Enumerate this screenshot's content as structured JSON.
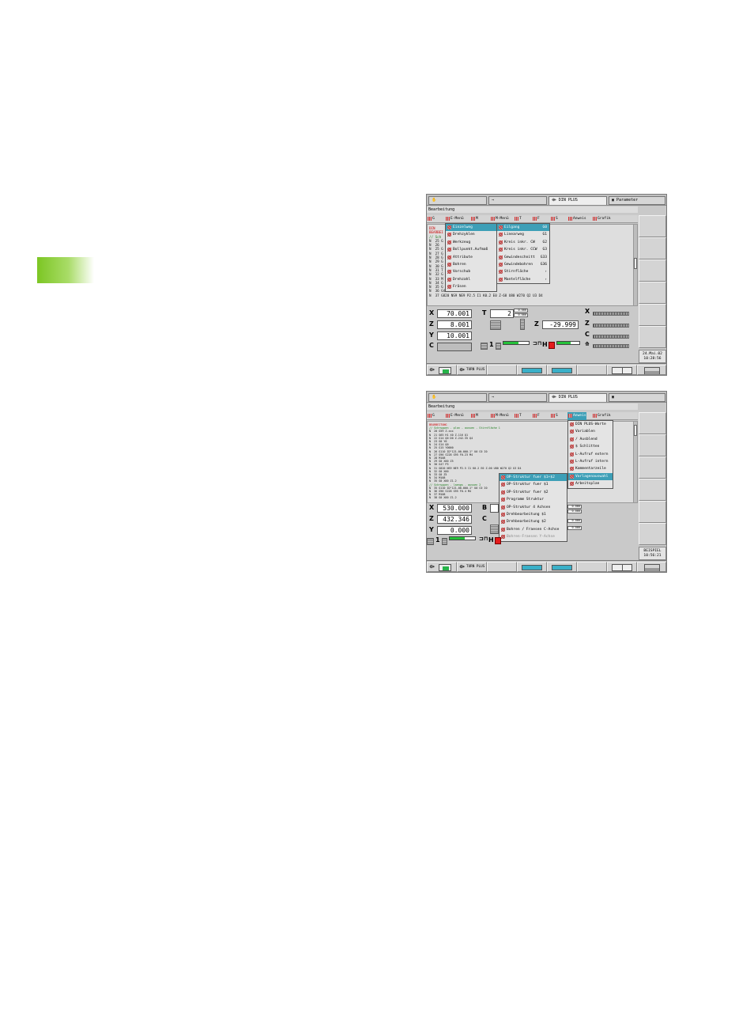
{
  "screens": [
    {
      "tabs": [
        "✋",
        "⇒",
        "DIN PLUS",
        "Parameter"
      ],
      "status": "Bearbeitung",
      "menubar": [
        "G",
        "E-Menü",
        "M",
        "M-Menü",
        "T",
        "F",
        "S",
        "Anweis",
        "Grafik"
      ],
      "program_lines": [
        {
          "t": "DIN",
          "c": "hd"
        },
        {
          "t": "BEARBEI",
          "c": "hd"
        },
        {
          "t": "// Sch",
          "c": "cm"
        },
        {
          "t": "N  25 G",
          "c": ""
        },
        {
          "t": "N  26 ",
          "c": ""
        },
        {
          "t": "N  25 G",
          "c": ""
        },
        {
          "t": "N  27 G",
          "c": ""
        },
        {
          "t": "N  28 G",
          "c": ""
        },
        {
          "t": "N  29 G",
          "c": ""
        },
        {
          "t": "N  30 G",
          "c": ""
        },
        {
          "t": "N  31 T",
          "c": ""
        },
        {
          "t": "N  32 G",
          "c": ""
        },
        {
          "t": "N  33 M",
          "c": ""
        },
        {
          "t": "N  34 G",
          "c": ""
        },
        {
          "t": "N  35 G",
          "c": ""
        },
        {
          "t": "N  36 G47 P3",
          "c": ""
        },
        {
          "t": "N  37 G820 NS9 NE9 P2.5 I1 K0.2 E0 Z-68 U80 W270 Q2 U3 D4",
          "c": ""
        }
      ],
      "submenu1": [
        "Einzelweg",
        "Drehzyklen",
        "Werkzeug",
        "Bollpunkt.Aufmaß",
        "Attribute",
        "Bohren",
        "Vorschub",
        "Drehzahl",
        "Fräsen"
      ],
      "submenu2": [
        {
          "label": "Eilgang",
          "code": "G0"
        },
        {
          "label": "Linearweg",
          "code": "G1"
        },
        {
          "label": "Kreis inkr. CW",
          "code": "G2"
        },
        {
          "label": "Kreis inkr. CCW",
          "code": "G3"
        },
        {
          "label": "Gewindeschnitt",
          "code": "G33"
        },
        {
          "label": "Gewindebohren",
          "code": "G36"
        },
        {
          "label": "Stirnfläche",
          "code": ""
        },
        {
          "label": "Mantelfläche",
          "code": ""
        }
      ],
      "axes": {
        "X": "70.001",
        "Z": "8.001",
        "Y": "10.001"
      },
      "tool": {
        "label": "T",
        "value": "2",
        "small": [
          "0.000",
          "0.000"
        ]
      },
      "z2": "-29.999",
      "h_label": "H",
      "counter": "1",
      "clock": [
        "24.Mai.02",
        "10:28:56"
      ],
      "bottom": [
        "TURN PLUS"
      ],
      "progress": {
        "fill": 0.6
      }
    },
    {
      "tabs": [
        "✋",
        "⇒",
        "DIN PLUS",
        ""
      ],
      "status": "Bearbeitung",
      "menubar": [
        "G",
        "E-Menü",
        "M",
        "M-Menü",
        "T",
        "F",
        "S",
        "Anweis",
        "Grafik"
      ],
      "program_lines": [
        {
          "t": "BEARBEITUNG",
          "c": "hd"
        },
        {
          "t": "// Schruppen - plan - aussen - Stirnfläche 1",
          "c": "cm"
        },
        {
          "t": "N  20 G59 Z.xxx",
          "c": ""
        },
        {
          "t": "N  21 G65 H1 X0 Z-116 Q1",
          "c": ""
        },
        {
          "t": "N  22 G14 Q0 D0 Z-242.35 Q4",
          "c": ""
        },
        {
          "t": "N  23 G0 Y0",
          "c": ""
        },
        {
          "t": "N  24 G14 Q0",
          "c": ""
        },
        {
          "t": "N  25 G15 Y0000",
          "c": ""
        },
        {
          "t": "N  26 G110 ID\"121-00-000.1\" U0 C0 I0",
          "c": ""
        },
        {
          "t": "N  27 G96 S228 G95 F0.23 M4",
          "c": ""
        },
        {
          "t": "N  28 M108",
          "c": ""
        },
        {
          "t": "N  29 G0 X00 Z5",
          "c": ""
        },
        {
          "t": "N  30 G47 P3",
          "c": ""
        },
        {
          "t": "N  31 G820 NS9 NE9 P2.5 I1 K0.2 E0 Z-00 U80 W270 Q2 U3 D4",
          "c": ""
        },
        {
          "t": "N  32 G0 X00",
          "c": ""
        },
        {
          "t": "N  33 G0 Z5",
          "c": ""
        },
        {
          "t": "N  34 M108",
          "c": ""
        },
        {
          "t": "N  35 G0 X00 Z1.2",
          "c": ""
        },
        {
          "t": "// Schruppen - laengs - aussen 2",
          "c": "cm"
        },
        {
          "t": "N  35 G110 ID\"121-00-000.1\" U0 C0 I0",
          "c": ""
        },
        {
          "t": "N  36 G96 S228 G95 F0.4 M4",
          "c": ""
        },
        {
          "t": "N  37 M108",
          "c": ""
        },
        {
          "t": "N  38 G0 X00 Z1.2",
          "c": ""
        }
      ],
      "submenu_anweis": [
        "DIN PLUS-Worte",
        "Variablen",
        "/ Ausblend",
        "$ Schlitten",
        "L-Aufruf extern",
        "L-Aufruf intern",
        "Kommentarzeile",
        "Vorlagenauswahl",
        "Arbeitsplan"
      ],
      "submenu_struct": [
        "OP-Struktur fuer $1+$2",
        "OP-Struktur fuer $1",
        "OP-Struktur fuer $2",
        "Programm Struktur",
        "OP-Struktur 4 Achsen",
        "Drehbearbeitung $1",
        "Drehbearbeitung $2",
        "Bohren / Fraesen C-Achse",
        "Bohren-Fraesen Y-Achse"
      ],
      "axes": {
        "X": "530.000",
        "Z": "432.346",
        "Y": "0.000"
      },
      "b_label": "B",
      "c_label": "C",
      "h_label": "H",
      "counter": "1",
      "small_vals": [
        "0.000",
        "0.000",
        "0.000",
        "0.000"
      ],
      "clock": [
        "BEISPIEL",
        "10:56:21"
      ],
      "bottom": [
        "TURN PLUS"
      ],
      "progress": {
        "fill": 0.6
      }
    }
  ]
}
